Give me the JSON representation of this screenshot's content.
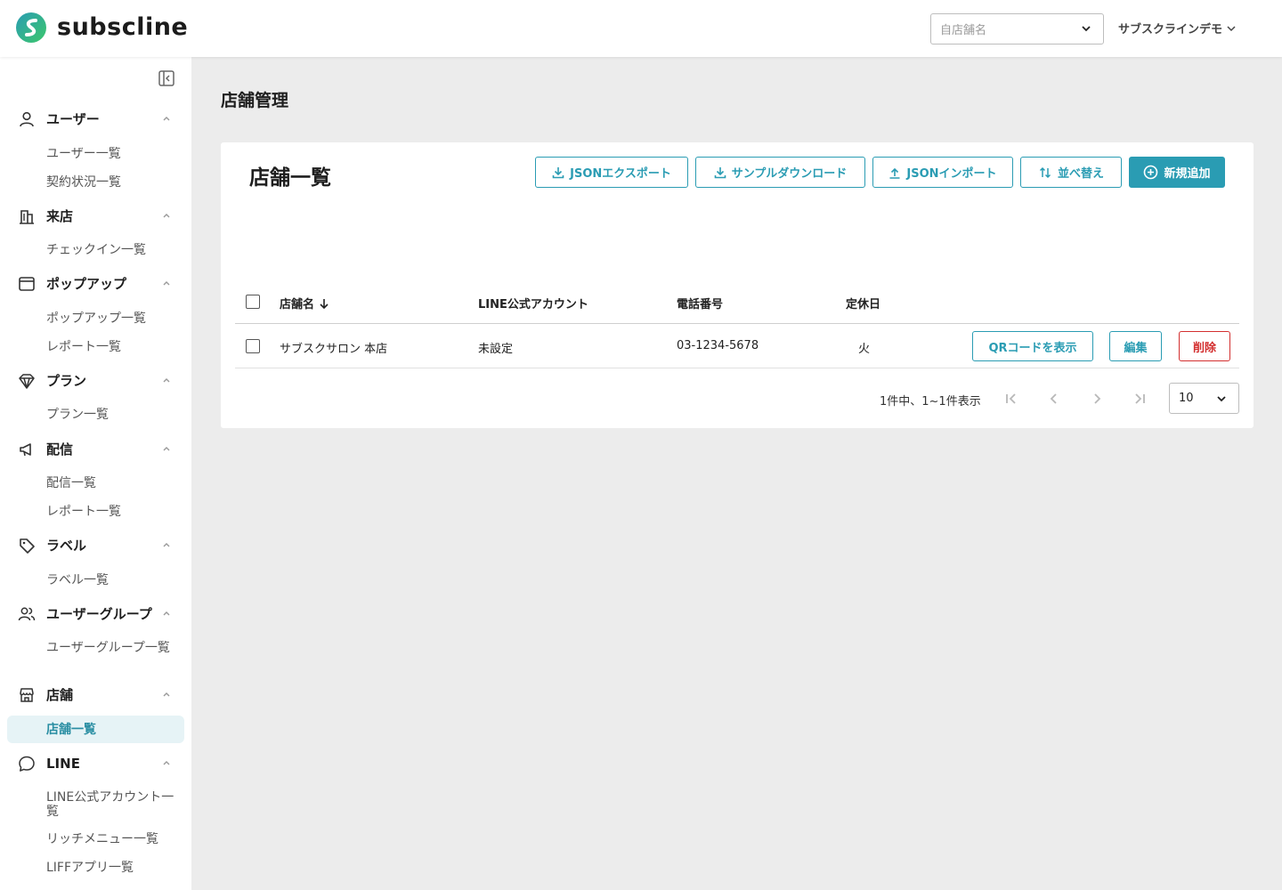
{
  "header": {
    "logo_text": "subscline",
    "shop_select_placeholder": "自店舗名",
    "user_menu_label": "サブスクラインデモ"
  },
  "sidebar": {
    "groups": [
      {
        "label": "ユーザー",
        "icon": "user-icon",
        "items": [
          "ユーザー一覧",
          "契約状況一覧"
        ]
      },
      {
        "label": "来店",
        "icon": "building-icon",
        "items": [
          "チェックイン一覧"
        ]
      },
      {
        "label": "ポップアップ",
        "icon": "window-icon",
        "items": [
          "ポップアップ一覧",
          "レポート一覧"
        ]
      },
      {
        "label": "プラン",
        "icon": "diamond-icon",
        "items": [
          "プラン一覧"
        ]
      },
      {
        "label": "配信",
        "icon": "megaphone-icon",
        "items": [
          "配信一覧",
          "レポート一覧"
        ]
      },
      {
        "label": "ラベル",
        "icon": "tag-icon",
        "items": [
          "ラベル一覧"
        ]
      },
      {
        "label": "ユーザーグループ",
        "icon": "users-icon",
        "items": [
          "ユーザーグループ一覧"
        ]
      },
      {
        "label": "店舗",
        "icon": "store-icon",
        "items": [
          "店舗一覧"
        ]
      },
      {
        "label": "LINE",
        "icon": "chat-bubble-icon",
        "items": [
          "LINE公式アカウント一覧",
          "リッチメニュー一覧",
          "LIFFアプリ一覧"
        ]
      }
    ],
    "active_item": "店舗一覧"
  },
  "page": {
    "title": "店舗管理",
    "card_title": "店舗一覧"
  },
  "toolbar": {
    "json_export": "JSONエクスポート",
    "sample_download": "サンプルダウンロード",
    "json_import": "JSONインポート",
    "sort": "並べ替え",
    "add_new": "新規追加"
  },
  "table": {
    "columns": [
      "店舗名",
      "LINE公式アカウント",
      "電話番号",
      "定休日"
    ],
    "sorted_column": "店舗名",
    "rows": [
      {
        "name": "サブスクサロン 本店",
        "line_account": "未設定",
        "phone": "03-1234-5678",
        "holiday": "火",
        "actions": {
          "qr": "QRコードを表示",
          "edit": "編集",
          "delete": "削除"
        }
      }
    ]
  },
  "pagination": {
    "summary": "1件中、1~1件表示",
    "per_page": "10"
  },
  "colors": {
    "accent": "#2a9cb3",
    "danger": "#d32f2f",
    "logo_green": "#2fbf71",
    "logo_teal": "#2a9cb3"
  }
}
